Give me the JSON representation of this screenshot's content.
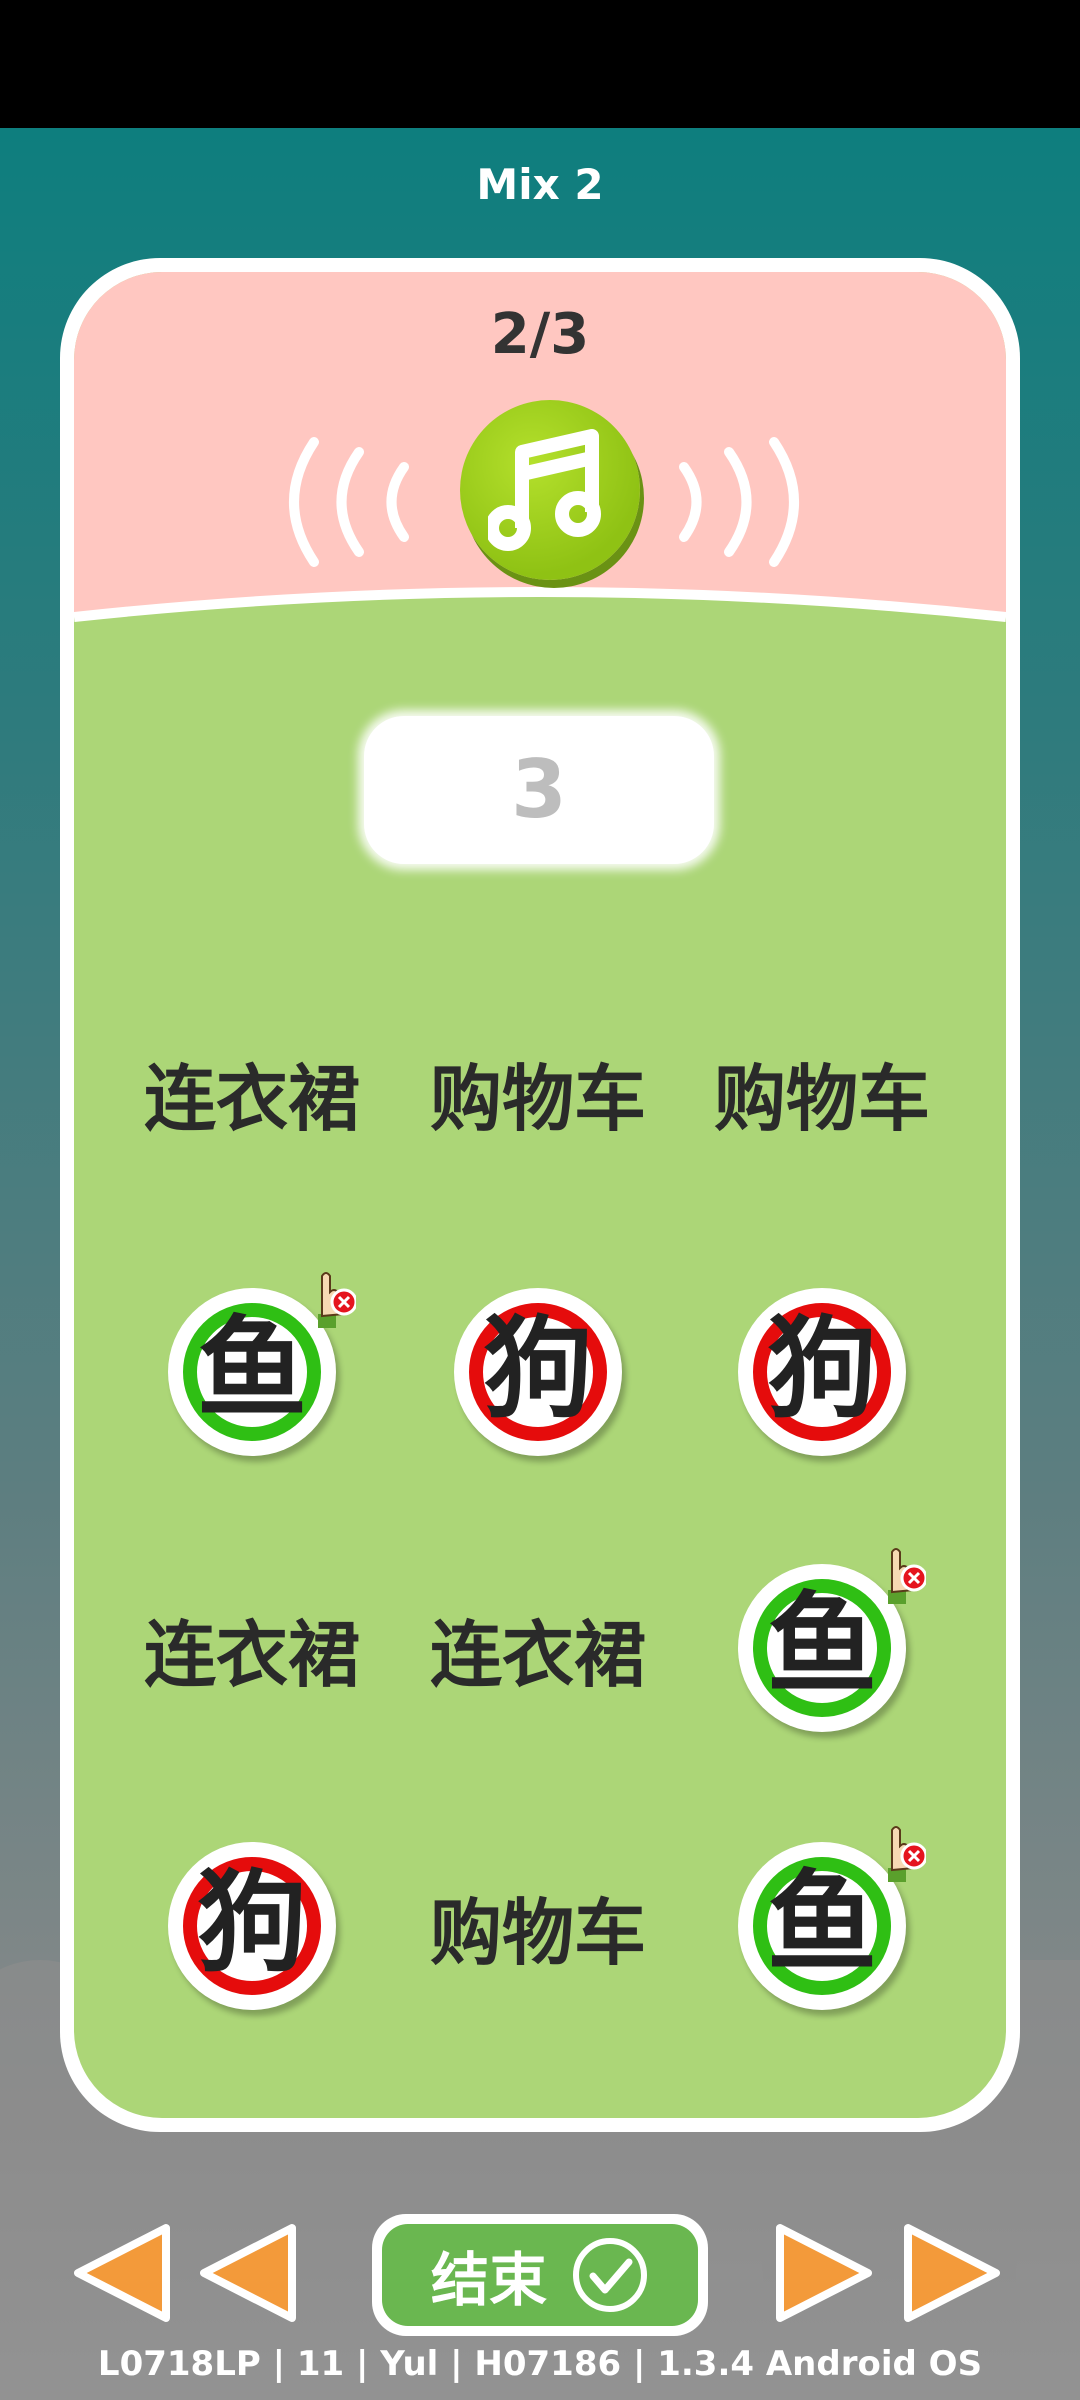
{
  "title": "Mix 2",
  "counter": "2/3",
  "answer": "3",
  "buttons": {
    "end_label": "结束"
  },
  "grid": {
    "r1c1": "连衣裙",
    "r1c2": "购物车",
    "r1c3": "购物车",
    "r2c1": "鱼",
    "r2c2": "狗",
    "r2c3": "狗",
    "r3c1": "连衣裙",
    "r3c2": "连衣裙",
    "r3c3": "鱼",
    "r4c1": "狗",
    "r4c2": "购物车",
    "r4c3": "鱼"
  },
  "footer": "L0718LP | 11 | Yul | H07186 | 1.3.4 Android OS",
  "colors": {
    "correct": "#2fbf14",
    "wrong": "#e50c0c",
    "accent": "#f39a3a"
  },
  "icons": [
    "music-note-icon",
    "sound-wave-icon",
    "hint-hand-icon",
    "check-circle-icon",
    "arrow-left-icon",
    "arrow-right-icon"
  ]
}
